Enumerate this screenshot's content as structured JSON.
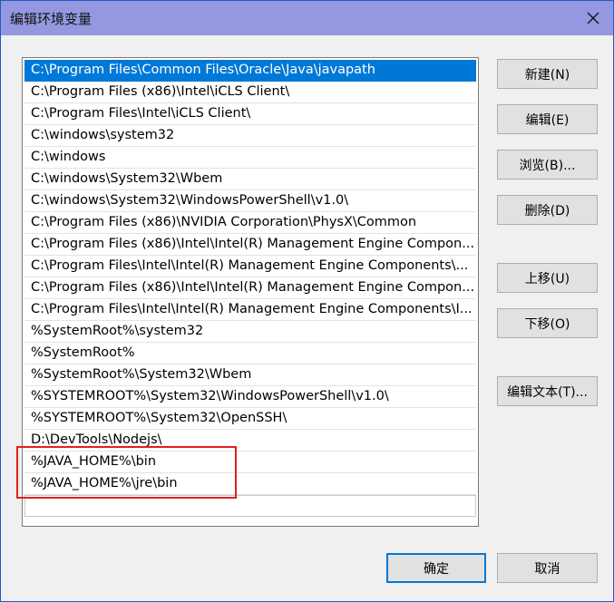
{
  "window": {
    "title": "编辑环境变量",
    "close_icon": "close-icon"
  },
  "path_list": {
    "selected_index": 0,
    "items": [
      "C:\\Program Files\\Common Files\\Oracle\\Java\\javapath",
      "C:\\Program Files (x86)\\Intel\\iCLS Client\\",
      "C:\\Program Files\\Intel\\iCLS Client\\",
      "C:\\windows\\system32",
      "C:\\windows",
      "C:\\windows\\System32\\Wbem",
      "C:\\windows\\System32\\WindowsPowerShell\\v1.0\\",
      "C:\\Program Files (x86)\\NVIDIA Corporation\\PhysX\\Common",
      "C:\\Program Files (x86)\\Intel\\Intel(R) Management Engine Compon...",
      "C:\\Program Files\\Intel\\Intel(R) Management Engine Components\\...",
      "C:\\Program Files (x86)\\Intel\\Intel(R) Management Engine Compon...",
      "C:\\Program Files\\Intel\\Intel(R) Management Engine Components\\I...",
      "%SystemRoot%\\system32",
      "%SystemRoot%",
      "%SystemRoot%\\System32\\Wbem",
      "%SYSTEMROOT%\\System32\\WindowsPowerShell\\v1.0\\",
      "%SYSTEMROOT%\\System32\\OpenSSH\\",
      "D:\\DevTools\\Nodejs\\",
      "%JAVA_HOME%\\bin",
      "%JAVA_HOME%\\jre\\bin",
      ""
    ]
  },
  "buttons": {
    "new": "新建(N)",
    "edit": "编辑(E)",
    "browse": "浏览(B)...",
    "delete": "删除(D)",
    "move_up": "上移(U)",
    "move_down": "下移(O)",
    "edit_text": "编辑文本(T)...",
    "ok": "确定",
    "cancel": "取消"
  },
  "colors": {
    "selection": "#0078d7",
    "title_bar": "#9598e0",
    "annotation": "#e02020"
  }
}
